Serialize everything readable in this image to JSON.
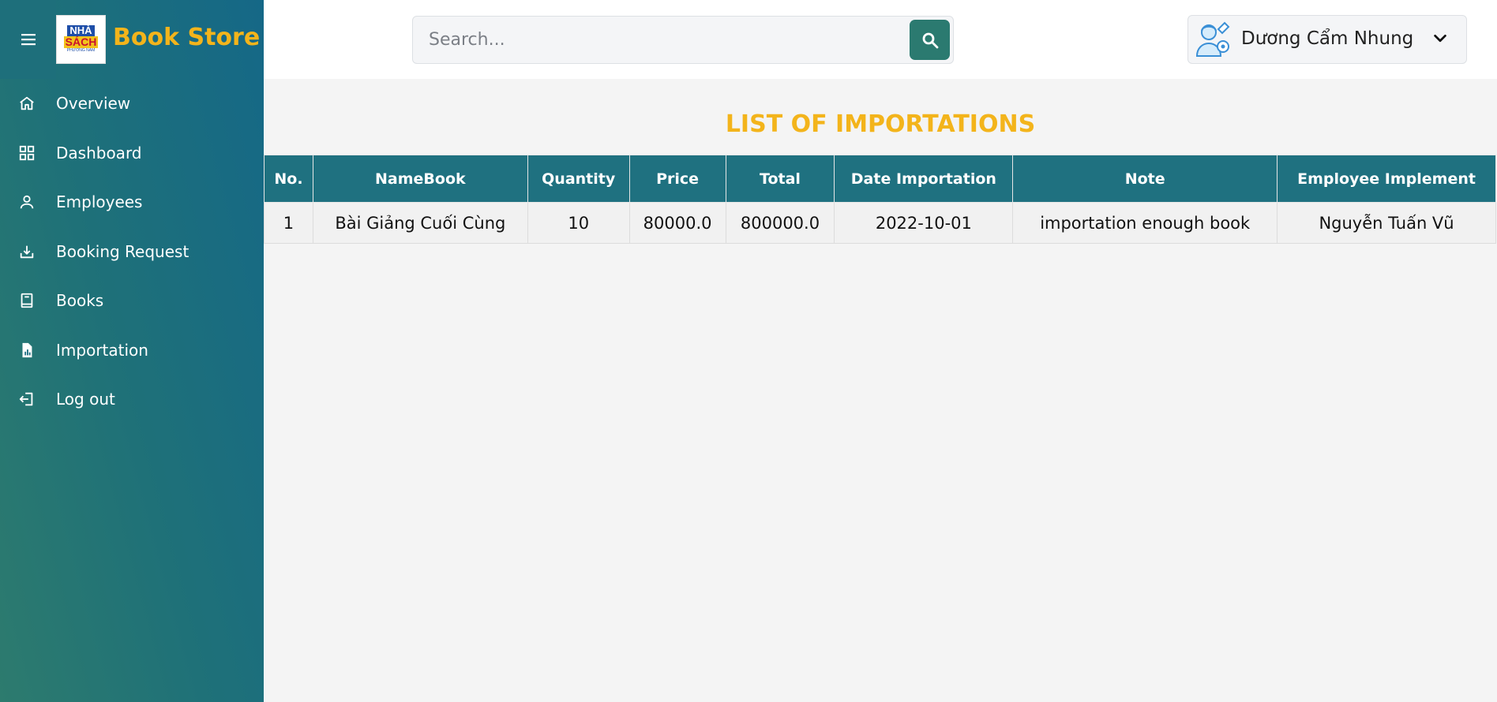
{
  "sidebar": {
    "brand": "Book Store",
    "logo": {
      "line1": "NHÀ",
      "line2": "SÁCH",
      "line3": "PHƯƠNG NAM"
    },
    "items": [
      {
        "label": "Overview",
        "icon": "home-icon"
      },
      {
        "label": "Dashboard",
        "icon": "grid-icon"
      },
      {
        "label": "Employees",
        "icon": "user-icon"
      },
      {
        "label": "Booking Request",
        "icon": "download-icon"
      },
      {
        "label": "Books",
        "icon": "book-icon"
      },
      {
        "label": "Importation",
        "icon": "document-chart-icon"
      },
      {
        "label": "Log out",
        "icon": "logout-icon"
      }
    ]
  },
  "header": {
    "search_placeholder": "Search...",
    "user_name": "Dương Cẩm Nhung"
  },
  "main": {
    "title": "LIST OF IMPORTATIONS",
    "columns": [
      "No.",
      "NameBook",
      "Quantity",
      "Price",
      "Total",
      "Date Importation",
      "Note",
      "Employee Implement"
    ],
    "rows": [
      [
        "1",
        "Bài Giảng Cuối Cùng",
        "10",
        "80000.0",
        "800000.0",
        "2022-10-01",
        "importation enough book",
        "Nguyễn Tuấn Vũ"
      ]
    ]
  },
  "colors": {
    "accent": "#f3b41b",
    "table_header": "#1f7180",
    "search_button": "#2b7a70"
  }
}
